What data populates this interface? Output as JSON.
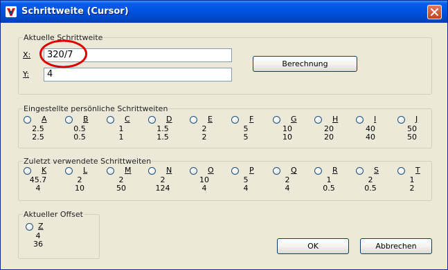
{
  "window": {
    "title": "Schrittweite (Cursor)"
  },
  "current": {
    "legend": "Aktuelle Schrittweite",
    "x_label": "X:",
    "x_value": "320/7",
    "y_label": "Y:",
    "y_value": "4",
    "calc_button": "Berechnung"
  },
  "personal": {
    "legend": "Eingestellte persönliche Schrittweiten",
    "items": [
      {
        "key": "A",
        "v1": "2.5",
        "v2": "2.5"
      },
      {
        "key": "B",
        "v1": "0.5",
        "v2": "0.5"
      },
      {
        "key": "C",
        "v1": "1",
        "v2": "1"
      },
      {
        "key": "D",
        "v1": "1.5",
        "v2": "1.5"
      },
      {
        "key": "E",
        "v1": "2",
        "v2": "2"
      },
      {
        "key": "F",
        "v1": "5",
        "v2": "5"
      },
      {
        "key": "G",
        "v1": "10",
        "v2": "10"
      },
      {
        "key": "H",
        "v1": "20",
        "v2": "20"
      },
      {
        "key": "I",
        "v1": "40",
        "v2": "40"
      },
      {
        "key": "J",
        "v1": "50",
        "v2": "50"
      }
    ]
  },
  "recent": {
    "legend": "Zuletzt verwendete Schrittweiten",
    "items": [
      {
        "key": "K",
        "v1": "45.7",
        "v2": "4"
      },
      {
        "key": "L",
        "v1": "2",
        "v2": "10"
      },
      {
        "key": "M",
        "v1": "2",
        "v2": "50"
      },
      {
        "key": "N",
        "v1": "2",
        "v2": "124"
      },
      {
        "key": "O",
        "v1": "10",
        "v2": "4"
      },
      {
        "key": "P",
        "v1": "5",
        "v2": "4"
      },
      {
        "key": "Q",
        "v1": "2",
        "v2": "4"
      },
      {
        "key": "R",
        "v1": "1",
        "v2": "0.5"
      },
      {
        "key": "S",
        "v1": "2",
        "v2": "0.5"
      },
      {
        "key": "T",
        "v1": "1",
        "v2": "2"
      }
    ]
  },
  "offset": {
    "legend": "Aktueller Offset",
    "key": "Z",
    "v1": "4",
    "v2": "36"
  },
  "buttons": {
    "ok": "OK",
    "cancel": "Abbrechen"
  },
  "colors": {
    "title_bar": "#0054e3",
    "face": "#ece9d8",
    "annotation": "#e00000",
    "close": "#c3411c"
  }
}
